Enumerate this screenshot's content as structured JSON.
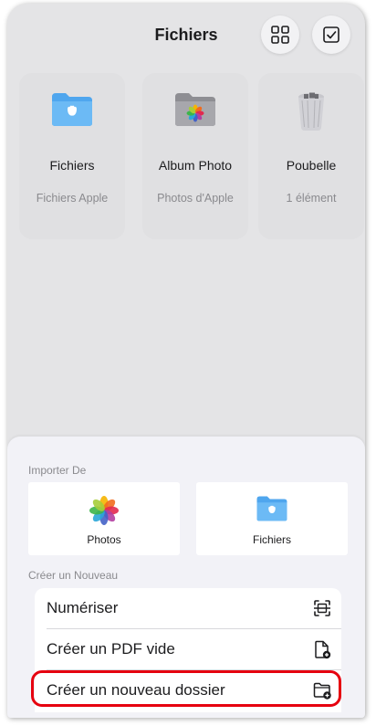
{
  "header": {
    "title": "Fichiers"
  },
  "locations": [
    {
      "name": "Fichiers",
      "subtitle": "Fichiers Apple",
      "icon": "blue-folder-icon"
    },
    {
      "name": "Album Photo",
      "subtitle": "Photos d'Apple",
      "icon": "photos-folder-icon"
    },
    {
      "name": "Poubelle",
      "subtitle": "1 élément",
      "icon": "trash-icon"
    }
  ],
  "sheet": {
    "import_label": "Importer De",
    "import_options": [
      {
        "label": "Photos",
        "icon": "photos-app-icon"
      },
      {
        "label": "Fichiers",
        "icon": "blue-folder-icon"
      }
    ],
    "create_label": "Créer un Nouveau",
    "create_options": [
      {
        "label": "Numériser",
        "icon": "scan-document-icon"
      },
      {
        "label": "Créer un PDF vide",
        "icon": "new-pdf-icon"
      },
      {
        "label": "Créer un nouveau dossier",
        "icon": "new-folder-icon"
      }
    ]
  },
  "colors": {
    "highlight": "#e6000f",
    "folder_blue": "#5ab0f0"
  }
}
